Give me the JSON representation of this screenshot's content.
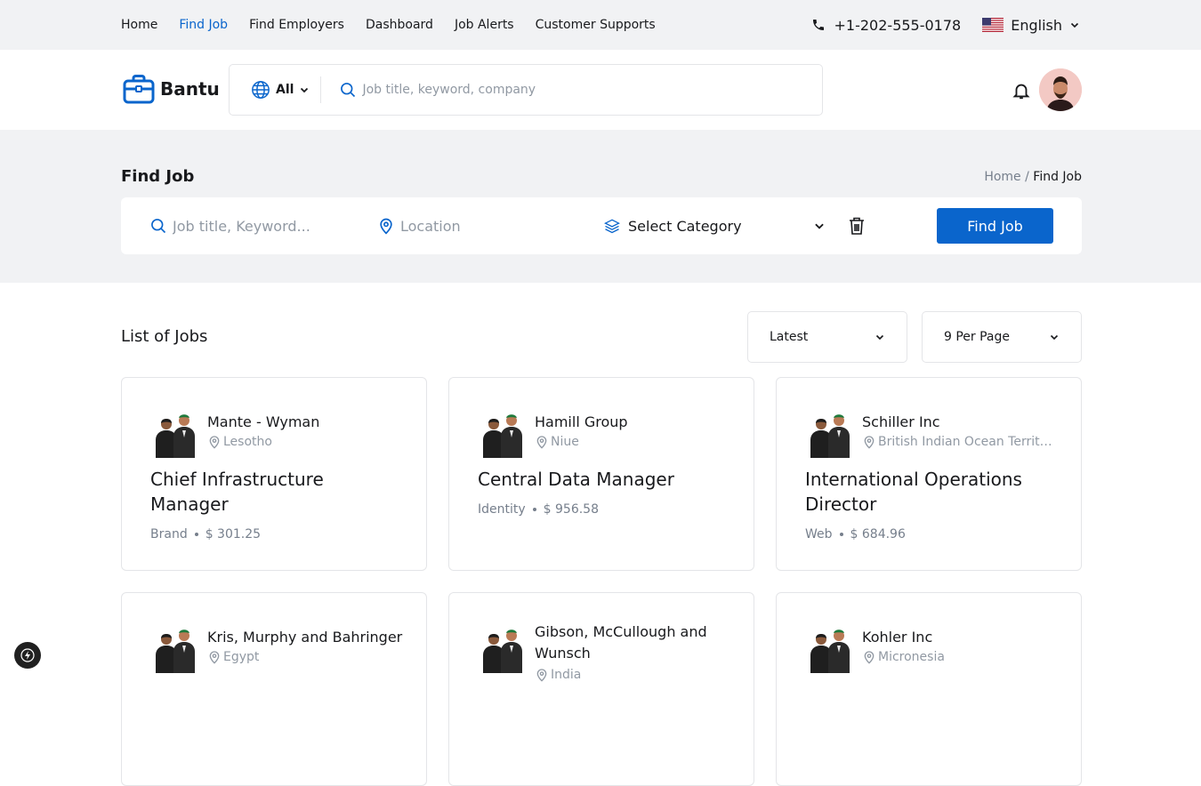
{
  "topbar": {
    "nav": [
      "Home",
      "Find Job",
      "Find Employers",
      "Dashboard",
      "Job Alerts",
      "Customer Supports"
    ],
    "active": "Find Job",
    "phone": "+1-202-555-0178",
    "language": "English"
  },
  "header": {
    "brand": "Bantu",
    "country": "All",
    "search_placeholder": "Job title, keyword, company"
  },
  "hero": {
    "title": "Find Job",
    "breadcrumb": {
      "home": "Home",
      "separator": "/",
      "current": "Find Job"
    },
    "filter": {
      "keyword_placeholder": "Job title, Keyword...",
      "location_placeholder": "Location",
      "category": "Select Category",
      "button": "Find Job"
    }
  },
  "list": {
    "title": "List of Jobs",
    "sort": "Latest",
    "per_page": "9 Per Page"
  },
  "jobs": [
    {
      "company": "Mante - Wyman",
      "location": "Lesotho",
      "title": "Chief Infrastructure Manager",
      "type": "Brand",
      "salary": "$ 301.25"
    },
    {
      "company": "Hamill Group",
      "location": "Niue",
      "title": "Central Data Manager",
      "type": "Identity",
      "salary": "$ 956.58"
    },
    {
      "company": "Schiller Inc",
      "location": "British Indian Ocean Territory",
      "title": "International Operations Director",
      "type": "Web",
      "salary": "$ 684.96"
    },
    {
      "company": "Kris, Murphy and Bahringer",
      "location": "Egypt"
    },
    {
      "company": "Gibson, McCullough and Wunsch",
      "location": "India"
    },
    {
      "company": "Kohler Inc",
      "location": "Micronesia"
    }
  ],
  "colors": {
    "primary": "#0a65cc",
    "topbar": "#f1f2f4",
    "border": "#e4e5e8",
    "muted": "#9199a3"
  }
}
